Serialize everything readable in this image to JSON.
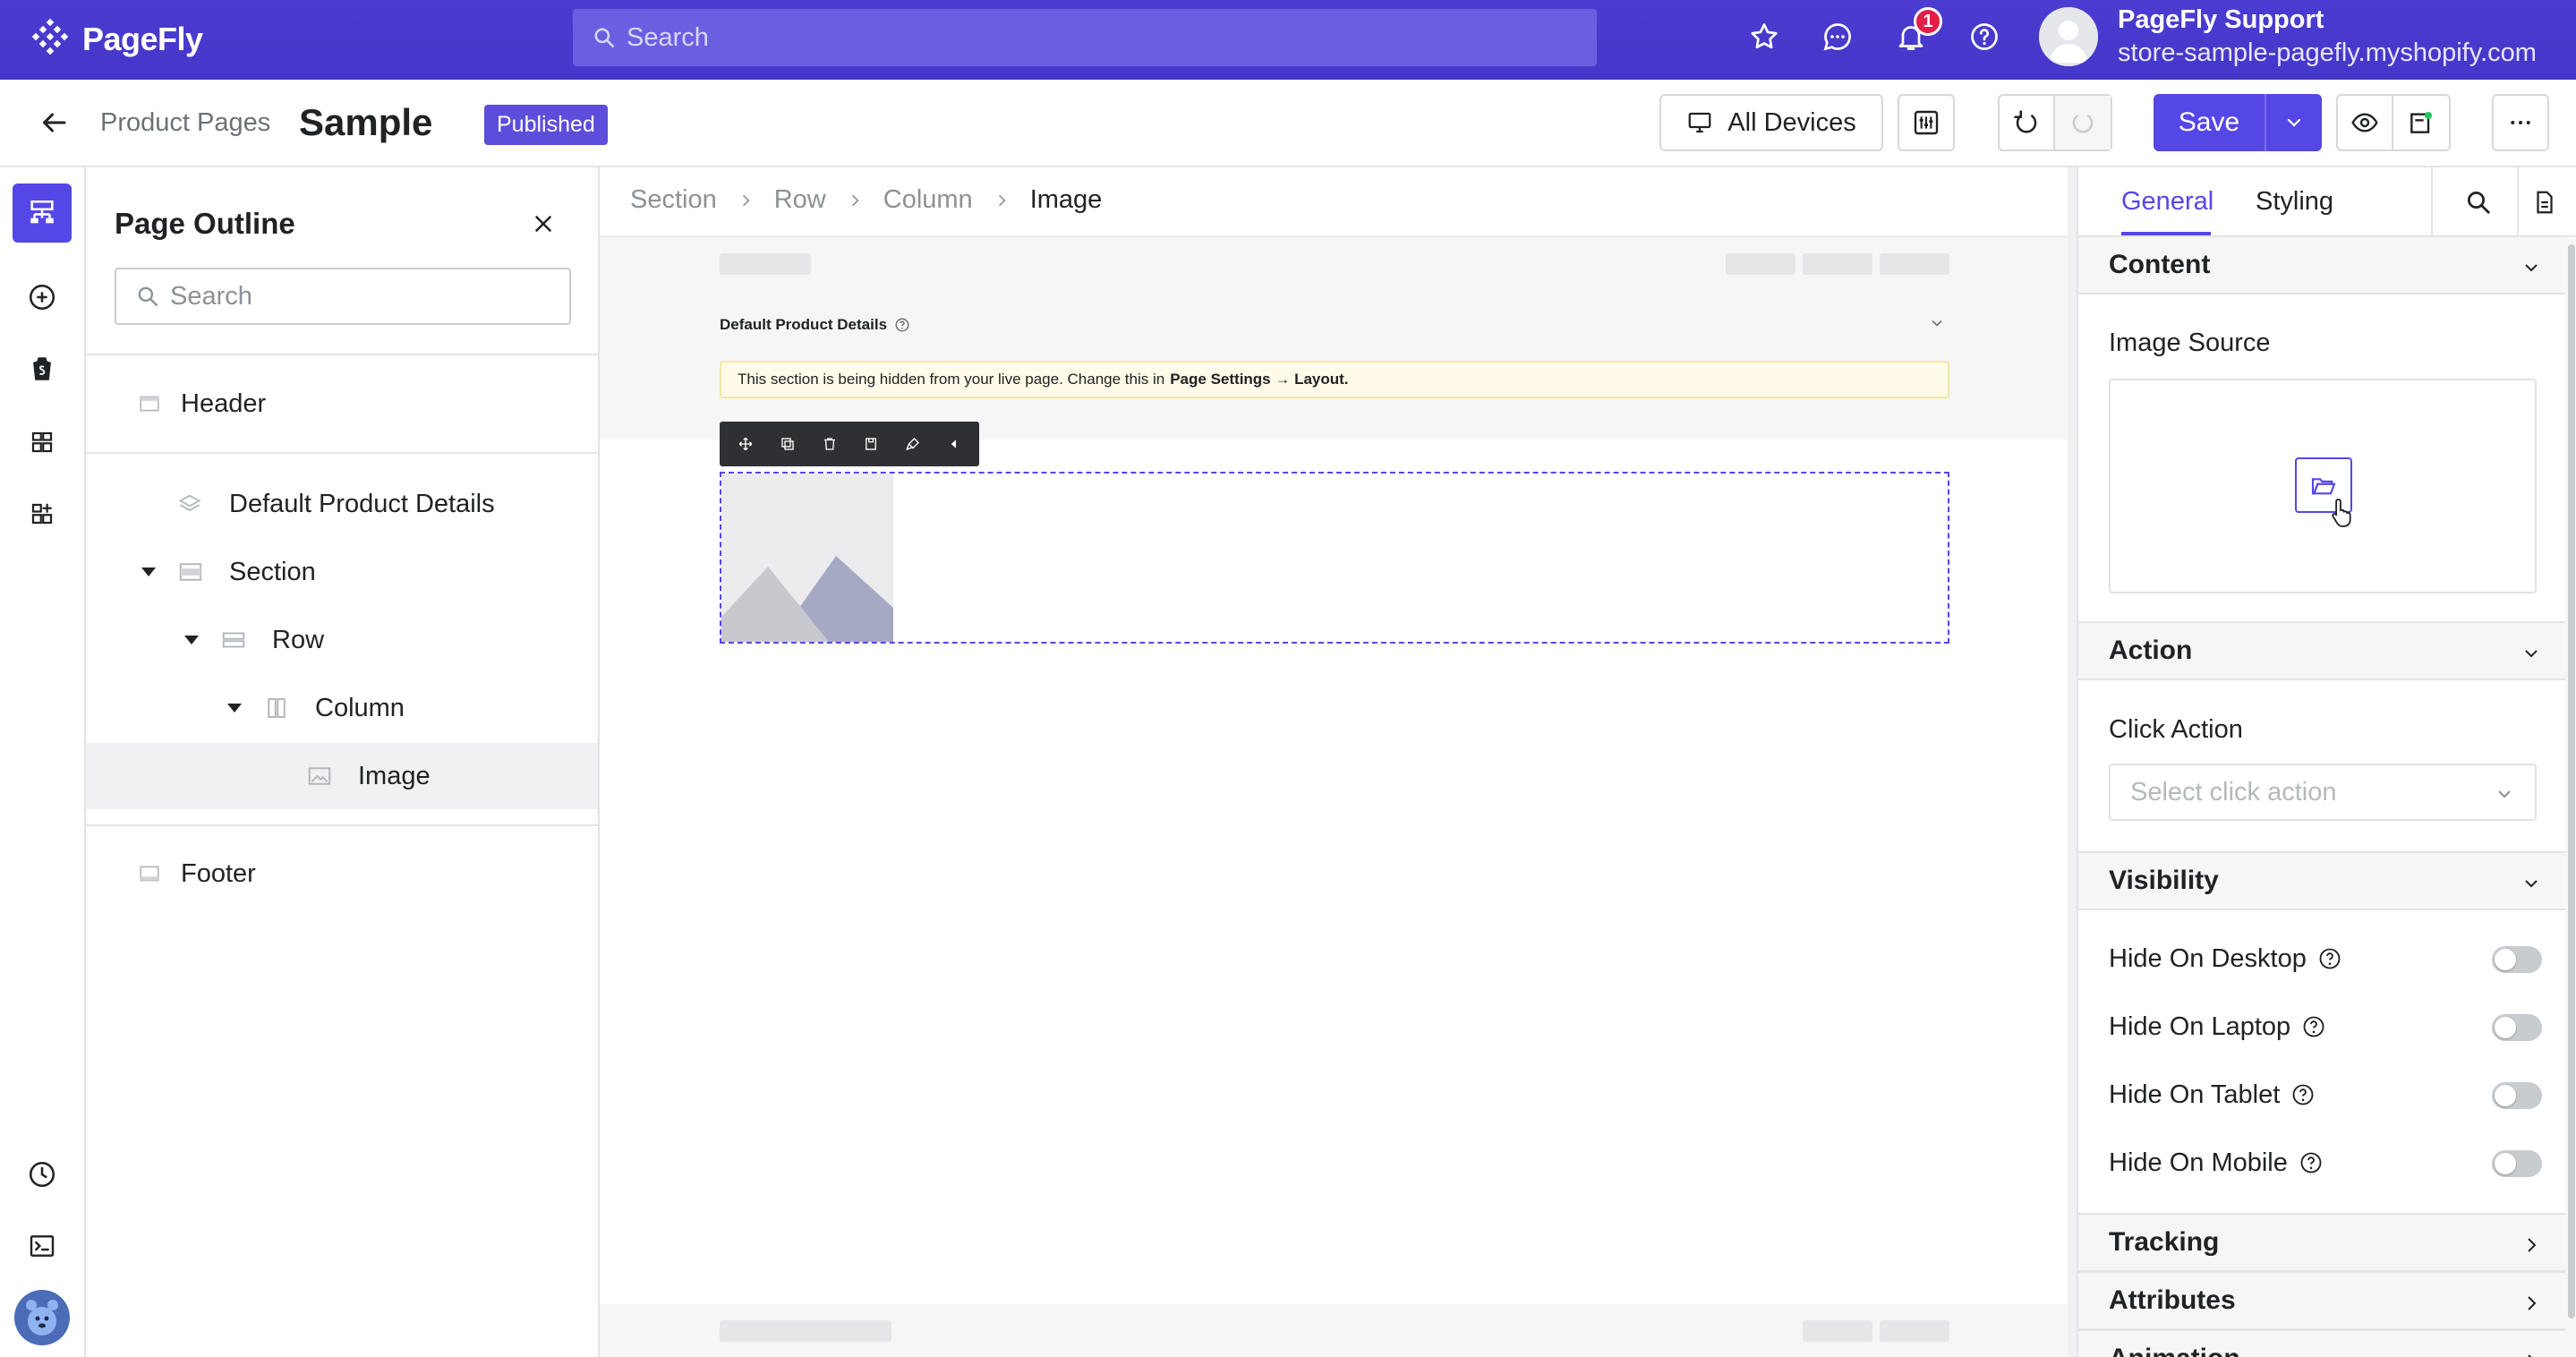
{
  "topbar": {
    "brand": "PageFly",
    "search_placeholder": "Search",
    "notification_count": "1",
    "user_name": "PageFly Support",
    "user_store": "store-sample-pagefly.myshopify.com"
  },
  "toolbar": {
    "breadcrumb": "Product Pages",
    "page_title": "Sample",
    "status_badge": "Published",
    "devices_label": "All Devices",
    "save_label": "Save"
  },
  "outline": {
    "title": "Page Outline",
    "search_placeholder": "Search",
    "items": [
      {
        "label": "Header"
      },
      {
        "label": "Default Product Details"
      },
      {
        "label": "Section"
      },
      {
        "label": "Row"
      },
      {
        "label": "Column"
      },
      {
        "label": "Image"
      },
      {
        "label": "Footer"
      }
    ]
  },
  "canvas": {
    "breadcrumbs": [
      "Section",
      "Row",
      "Column",
      "Image"
    ],
    "section_label": "Default Product Details",
    "notice_text": "This section is being hidden from your live page. Change this in",
    "notice_bold": "Page Settings → Layout."
  },
  "panel": {
    "tabs": [
      "General",
      "Styling"
    ],
    "sections": {
      "content": "Content",
      "action": "Action",
      "visibility": "Visibility",
      "tracking": "Tracking",
      "attributes": "Attributes",
      "animation": "Animation"
    },
    "image_source_label": "Image Source",
    "click_action_label": "Click Action",
    "click_action_placeholder": "Select click action",
    "visibility_options": [
      {
        "label": "Hide On Desktop",
        "enabled": false
      },
      {
        "label": "Hide On Laptop",
        "enabled": false
      },
      {
        "label": "Hide On Tablet",
        "enabled": false
      },
      {
        "label": "Hide On Mobile",
        "enabled": false
      }
    ]
  },
  "colors": {
    "brand": "#4b3cd1",
    "accent": "#5546e6",
    "notice_bg": "#fffbe8"
  }
}
